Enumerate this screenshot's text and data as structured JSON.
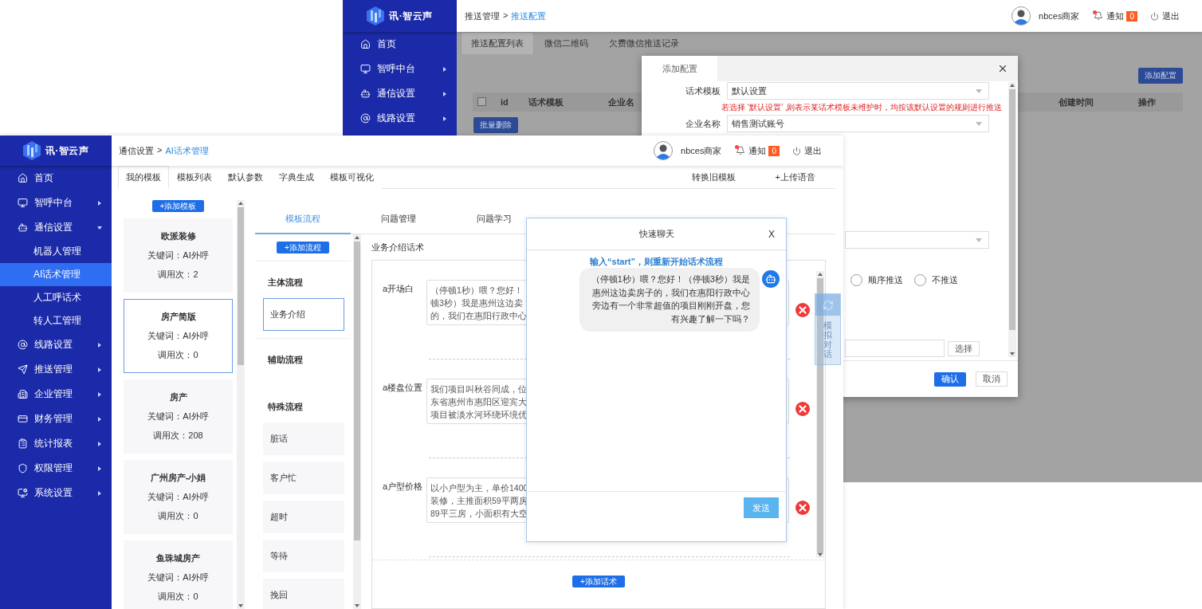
{
  "back_window": {
    "logo": "讯·智云声",
    "menu": [
      {
        "label": "首页"
      },
      {
        "label": "智呼中台",
        "expanded": false
      },
      {
        "label": "通信设置",
        "expanded": false
      },
      {
        "label": "线路设置",
        "expanded": false
      }
    ],
    "breadcrumb": {
      "parent": "推送管理",
      "separator": ">",
      "current": "推送配置"
    },
    "user": {
      "name": "nbces商家",
      "notice": "通知",
      "notice_count": "0",
      "logout": "退出"
    },
    "tabs": [
      {
        "label": "推送配置列表",
        "selected": true
      },
      {
        "label": "微信二维码",
        "selected": false
      },
      {
        "label": "欠费微信推送记录",
        "selected": false
      }
    ],
    "add_button": "添加配置",
    "table": {
      "select_all_checked": false,
      "columns": [
        "id",
        "话术模板",
        "企业名",
        "创建时间",
        "操作"
      ]
    },
    "batch_delete": "批量删除"
  },
  "dialog": {
    "tab": "添加配置",
    "fields": [
      {
        "kind": "select",
        "label": "话术模板",
        "value": "默认设置",
        "hint": "若选择 ‘默认设置’ ,则表示某话术模板未维护时，均按该默认设置的规则进行推送"
      },
      {
        "kind": "select",
        "label": "企业名称",
        "value": "销售测试账号"
      },
      {
        "kind": "select"
      },
      {
        "kind": "radio",
        "options": [
          {
            "label": "顺序推送",
            "checked": false
          },
          {
            "label": "不推送",
            "checked": false
          }
        ]
      },
      {
        "kind": "picker",
        "button": "选择"
      }
    ],
    "confirm": "确认",
    "cancel": "取消"
  },
  "front_window": {
    "logo": "讯·智云声",
    "menu": [
      {
        "label": "首页"
      },
      {
        "label": "智呼中台",
        "expanded": false
      },
      {
        "label": "通信设置",
        "expanded": true,
        "children": [
          {
            "label": "机器人管理",
            "selected": false
          },
          {
            "label": "AI话术管理",
            "selected": true
          },
          {
            "label": "人工呼话术",
            "selected": false
          },
          {
            "label": "转人工管理",
            "selected": false
          }
        ]
      },
      {
        "label": "线路设置",
        "expanded": false
      },
      {
        "label": "推送管理",
        "expanded": false
      },
      {
        "label": "企业管理",
        "expanded": false
      },
      {
        "label": "财务管理",
        "expanded": false
      },
      {
        "label": "统计报表",
        "expanded": false
      },
      {
        "label": "权限管理",
        "expanded": false
      },
      {
        "label": "系统设置",
        "expanded": false
      }
    ],
    "breadcrumb": {
      "parent": "通信设置",
      "separator": ">",
      "current": "AI话术管理"
    },
    "user": {
      "name": "nbces商家",
      "notice": "通知",
      "notice_count": "0",
      "logout": "退出"
    },
    "tabs": [
      {
        "label": "我的模板",
        "selected": true
      },
      {
        "label": "模板列表",
        "selected": false
      },
      {
        "label": "默认参数",
        "selected": false
      },
      {
        "label": "字典生成",
        "selected": false
      },
      {
        "label": "模板可视化",
        "selected": false
      }
    ],
    "actions": [
      "转换旧模板",
      "+上传语音"
    ],
    "add_template": "+添加模板",
    "templates": [
      {
        "name": "欧派装修",
        "keyword": "关键词：AI外呼",
        "calls": "调用次：2",
        "selected": false
      },
      {
        "name": "房产简版",
        "keyword": "关键词：AI外呼",
        "calls": "调用次：0",
        "selected": true
      },
      {
        "name": "房产",
        "keyword": "关键词：AI外呼",
        "calls": "调用次：208",
        "selected": false
      },
      {
        "name": "广州房产-小娟",
        "keyword": "关键词：AI外呼",
        "calls": "调用次：0",
        "selected": false
      },
      {
        "name": "鱼珠城房产",
        "keyword": "关键词：AI外呼",
        "calls": "调用次：0",
        "selected": false
      }
    ],
    "panel_tabs": [
      {
        "label": "模板流程",
        "selected": true
      },
      {
        "label": "问题管理",
        "selected": false
      },
      {
        "label": "问题学习",
        "selected": false
      }
    ],
    "add_flow": "+添加流程",
    "flow_groups": [
      {
        "title": "主体流程",
        "items": [
          {
            "label": "业务介绍",
            "selected": true
          }
        ]
      },
      {
        "title": "辅助流程"
      },
      {
        "title": "特殊流程",
        "items": [
          {
            "label": "脏话",
            "selected": false
          },
          {
            "label": "客户忙",
            "selected": false
          },
          {
            "label": "超时",
            "selected": false
          },
          {
            "label": "等待",
            "selected": false
          },
          {
            "label": "挽回",
            "selected": false
          }
        ]
      }
    ],
    "detail": {
      "title": "业务介绍话术",
      "rows": [
        {
          "label": "a开场白",
          "lines": [
            "（停顿1秒）喂？您好！",
            "顿3秒）我是惠州这边卖",
            "的，我们在惠阳行政中心"
          ]
        },
        {
          "label": "a楼盘位置",
          "lines": [
            "我们项目叫秋谷同成，位",
            "东省惠州市惠阳区迎宾大",
            "项目被淡水河环绕环境优"
          ]
        },
        {
          "label": "a户型价格",
          "lines": [
            "以小户型为主，单价1400",
            "装修，主推面积59平两房",
            "89平三房，小面积有大空"
          ]
        }
      ],
      "add_button": "+添加话术"
    },
    "chat": {
      "title": "快速聊天",
      "close": "X",
      "hint": "输入“start”，则重新开始话术流程",
      "messages": [
        {
          "kind": "bot",
          "text": "（停顿1秒）喂？您好！（停顿3秒）我是惠州这边卖房子的，我们在惠阳行政中心旁边有一个非常超值的项目刚刚开盘，您有兴趣了解一下吗？"
        }
      ],
      "send": "发送"
    },
    "float_button": "模拟对话"
  }
}
